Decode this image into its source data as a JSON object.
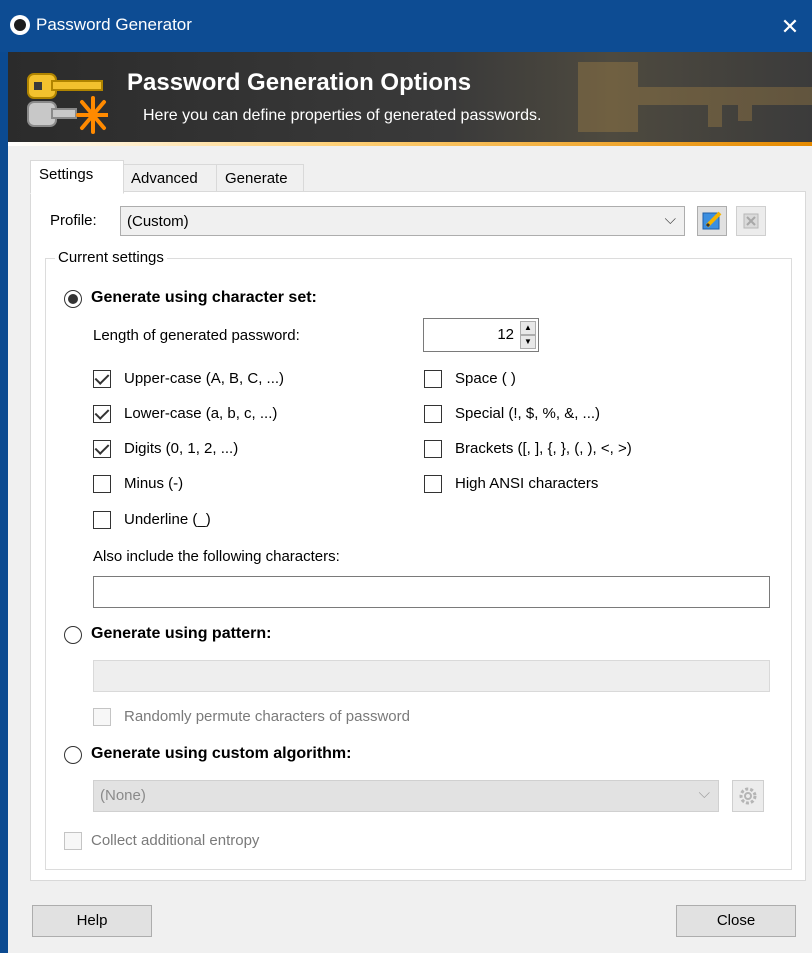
{
  "window": {
    "title": "Password Generator",
    "close_glyph": "✕",
    "app_icon": "lock-icon"
  },
  "banner": {
    "heading": "Password Generation Options",
    "subtitle": "Here you can define properties of generated passwords.",
    "icon": "key-icon"
  },
  "tabs": [
    {
      "label": "Settings",
      "active": true
    },
    {
      "label": "Advanced",
      "active": false
    },
    {
      "label": "Generate",
      "active": false
    }
  ],
  "profile": {
    "label": "Profile:",
    "value": "(Custom)",
    "edit_icon": "edit-profile-icon",
    "delete_icon": "delete-profile-icon"
  },
  "current_settings": {
    "group_label": "Current settings",
    "charset": {
      "label": "Generate using character set:",
      "selected": true,
      "length_label": "Length of generated password:",
      "length_value": "12",
      "options_left": [
        {
          "label": "Upper-case (A, B, C, ...)",
          "checked": true
        },
        {
          "label": "Lower-case (a, b, c, ...)",
          "checked": true
        },
        {
          "label": "Digits (0, 1, 2, ...)",
          "checked": true
        },
        {
          "label": "Minus (-)",
          "checked": false
        },
        {
          "label": "Underline (_)",
          "checked": false
        }
      ],
      "options_right": [
        {
          "label": "Space ( )",
          "checked": false
        },
        {
          "label": "Special (!, $, %, &, ...)",
          "checked": false
        },
        {
          "label": "Brackets ([, ], {, }, (, ), <, >)",
          "checked": false
        },
        {
          "label": "High ANSI characters",
          "checked": false
        }
      ],
      "also_include_label": "Also include the following characters:",
      "also_include_value": ""
    },
    "pattern": {
      "label": "Generate using pattern:",
      "selected": false,
      "value": "",
      "permute_label": "Randomly permute characters of password",
      "permute_checked": false
    },
    "custom": {
      "label": "Generate using custom algorithm:",
      "selected": false,
      "value": "(None)",
      "settings_icon": "gear-icon"
    },
    "entropy_label": "Collect additional entropy",
    "entropy_checked": false
  },
  "footer": {
    "help_label": "Help",
    "close_label": "Close"
  }
}
